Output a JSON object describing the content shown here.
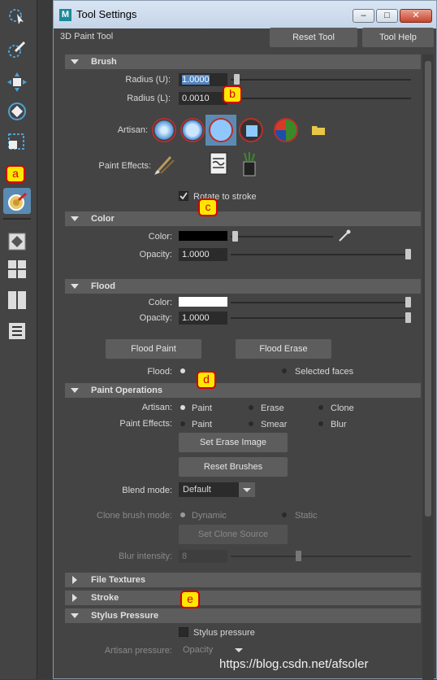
{
  "window": {
    "title": "Tool Settings",
    "tool_name": "3D Paint Tool",
    "logo": "M",
    "buttons": {
      "reset": "Reset Tool",
      "help": "Tool Help"
    }
  },
  "shelf": {
    "icons": [
      "lasso-select-icon",
      "paint-select-icon",
      "move-icon",
      "rotate-icon",
      "scale-icon",
      "3d-paint-icon",
      "single-pane-icon",
      "four-pane-icon",
      "two-pane-icon",
      "outliner-icon"
    ]
  },
  "annotations": [
    "a",
    "b",
    "c",
    "d",
    "e"
  ],
  "brush": {
    "title": "Brush",
    "radius_u_label": "Radius (U):",
    "radius_u": "1.0000",
    "radius_l_label": "Radius (L):",
    "radius_l": "0.0010",
    "artisan_label": "Artisan:",
    "paint_effects_label": "Paint Effects:",
    "rotate_label": "Rotate to stroke"
  },
  "color": {
    "title": "Color",
    "color_label": "Color:",
    "opacity_label": "Opacity:",
    "opacity": "1.0000"
  },
  "flood": {
    "title": "Flood",
    "color_label": "Color:",
    "opacity_label": "Opacity:",
    "opacity": "1.0000",
    "paint_btn": "Flood Paint",
    "erase_btn": "Flood Erase",
    "flood_label": "Flood:",
    "flood_opt2": "Selected faces"
  },
  "ops": {
    "title": "Paint Operations",
    "artisan_label": "Artisan:",
    "a1": "Paint",
    "a2": "Erase",
    "a3": "Clone",
    "pe_label": "Paint Effects:",
    "p1": "Paint",
    "p2": "Smear",
    "p3": "Blur",
    "set_erase": "Set Erase Image",
    "reset_brushes": "Reset Brushes",
    "blend_label": "Blend mode:",
    "blend_value": "Default",
    "clone_label": "Clone brush mode:",
    "c1": "Dynamic",
    "c2": "Static",
    "set_clone": "Set Clone Source",
    "blur_label": "Blur intensity:",
    "blur_value": "8"
  },
  "collapsed": {
    "file_textures": "File Textures",
    "stroke": "Stroke",
    "stylus": "Stylus Pressure"
  },
  "stylus": {
    "chk_label": "Stylus pressure",
    "artisan_label": "Artisan pressure:",
    "artisan_value": "Opacity"
  },
  "watermark": "https://blog.csdn.net/afsoler"
}
